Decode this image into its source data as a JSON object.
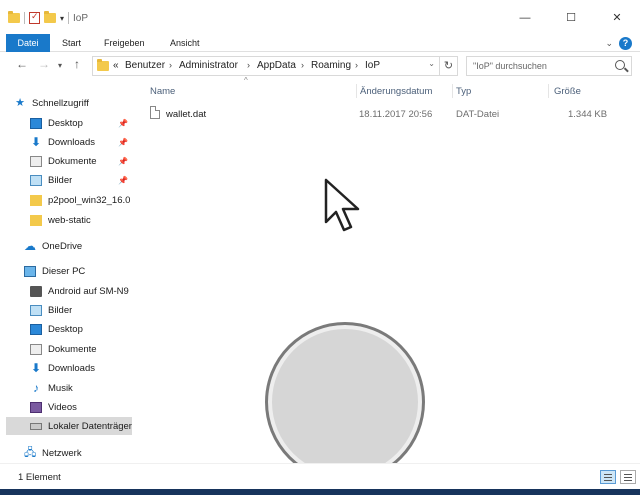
{
  "window": {
    "title": "IoP"
  },
  "ribbon": {
    "tabs": [
      "Datei",
      "Start",
      "Freigeben",
      "Ansicht"
    ]
  },
  "address": {
    "overflow": "«",
    "crumbs": [
      "Benutzer",
      "Administrator",
      "AppData",
      "Roaming",
      "IoP"
    ],
    "search_placeholder": "\"IoP\" durchsuchen"
  },
  "nav": {
    "quick_access": "Schnellzugriff",
    "quick_items": [
      {
        "label": "Desktop",
        "icon": "desktop-icon"
      },
      {
        "label": "Downloads",
        "icon": "download-icon"
      },
      {
        "label": "Dokumente",
        "icon": "documents-icon"
      },
      {
        "label": "Bilder",
        "icon": "pictures-icon"
      },
      {
        "label": "p2pool_win32_16.0",
        "icon": "folder-icon"
      },
      {
        "label": "web-static",
        "icon": "folder-icon"
      }
    ],
    "onedrive": "OneDrive",
    "this_pc": "Dieser PC",
    "pc_items": [
      {
        "label": "Android auf SM-N9",
        "icon": "phone-icon"
      },
      {
        "label": "Bilder",
        "icon": "pictures-icon"
      },
      {
        "label": "Desktop",
        "icon": "desktop-icon"
      },
      {
        "label": "Dokumente",
        "icon": "documents-icon"
      },
      {
        "label": "Downloads",
        "icon": "download-icon"
      },
      {
        "label": "Musik",
        "icon": "music-icon"
      },
      {
        "label": "Videos",
        "icon": "videos-icon"
      },
      {
        "label": "Lokaler Datenträger",
        "icon": "drive-icon"
      }
    ],
    "network": "Netzwerk"
  },
  "columns": {
    "name": "Name",
    "date": "Änderungsdatum",
    "type": "Typ",
    "size": "Größe"
  },
  "files": [
    {
      "name": "wallet.dat",
      "date": "18.11.2017 20:56",
      "type": "DAT-Datei",
      "size": "1.344 KB"
    }
  ],
  "status": {
    "text": "1 Element"
  },
  "colors": {
    "accent": "#1979ca",
    "selected": "#d9d9d9",
    "taskbar": "#17345c"
  }
}
